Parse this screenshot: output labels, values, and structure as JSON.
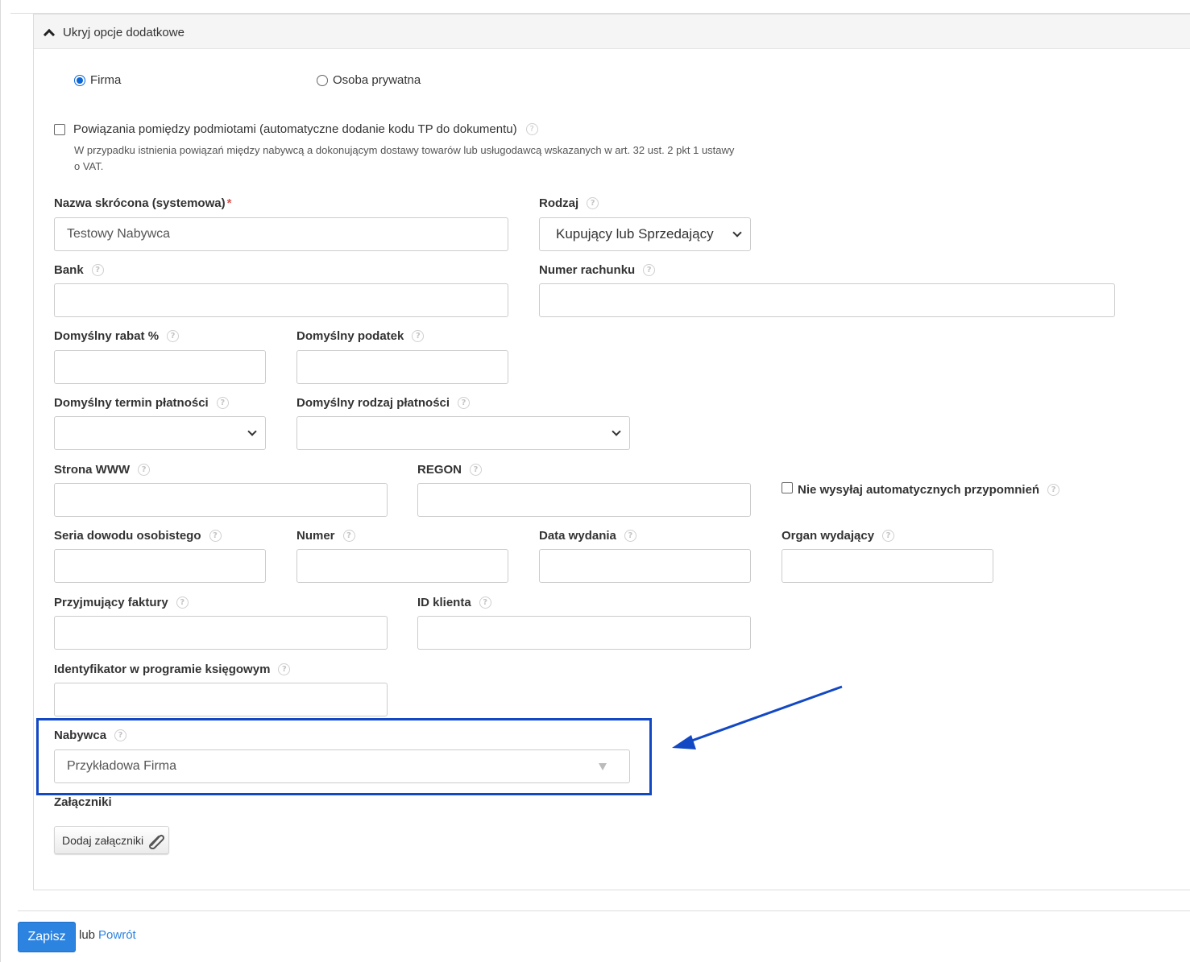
{
  "panel": {
    "toggle_label": "Ukryj opcje dodatkowe"
  },
  "entity_type": {
    "firma": "Firma",
    "osoba": "Osoba prywatna",
    "selected": "Firma"
  },
  "related": {
    "label": "Powiązania pomiędzy podmiotami (automatyczne dodanie kodu TP do dokumentu)",
    "hint": "W przypadku istnienia powiązań między nabywcą a dokonującym dostawy towarów lub usługodawcą wskazanych w art. 32 ust. 2 pkt 1 ustawy o VAT."
  },
  "fields": {
    "short_name": {
      "label": "Nazwa skrócona (systemowa)",
      "required_mark": "*",
      "value": "Testowy Nabywca"
    },
    "kind": {
      "label": "Rodzaj",
      "value": "Kupujący lub Sprzedający"
    },
    "bank": {
      "label": "Bank",
      "value": ""
    },
    "account": {
      "label": "Numer rachunku",
      "value": ""
    },
    "discount": {
      "label": "Domyślny rabat %",
      "value": ""
    },
    "tax": {
      "label": "Domyślny podatek",
      "value": ""
    },
    "payment_term": {
      "label": "Domyślny termin płatności",
      "value": ""
    },
    "payment_type": {
      "label": "Domyślny rodzaj płatności",
      "value": ""
    },
    "www": {
      "label": "Strona WWW",
      "value": ""
    },
    "regon": {
      "label": "REGON",
      "value": ""
    },
    "no_reminders": {
      "label": "Nie wysyłaj automatycznych przypomnień",
      "checked": false
    },
    "id_series": {
      "label": "Seria dowodu osobistego",
      "value": ""
    },
    "id_number": {
      "label": "Numer",
      "value": ""
    },
    "issue_date": {
      "label": "Data wydania",
      "value": ""
    },
    "issuer": {
      "label": "Organ wydający",
      "value": ""
    },
    "invoice_receiver": {
      "label": "Przyjmujący faktury",
      "value": ""
    },
    "client_id": {
      "label": "ID klienta",
      "value": ""
    },
    "accounting_id": {
      "label": "Identyfikator w programie księgowym",
      "value": ""
    },
    "buyer": {
      "label": "Nabywca",
      "value": "Przykładowa Firma"
    }
  },
  "attachments": {
    "label": "Załączniki",
    "button": "Dodaj załączniki"
  },
  "footer": {
    "save": "Zapisz",
    "or": "lub",
    "back": "Powrót"
  },
  "help_glyph": "?",
  "colors": {
    "accent": "#2c83e0",
    "highlight": "#1248c4",
    "required": "#d9534f"
  }
}
